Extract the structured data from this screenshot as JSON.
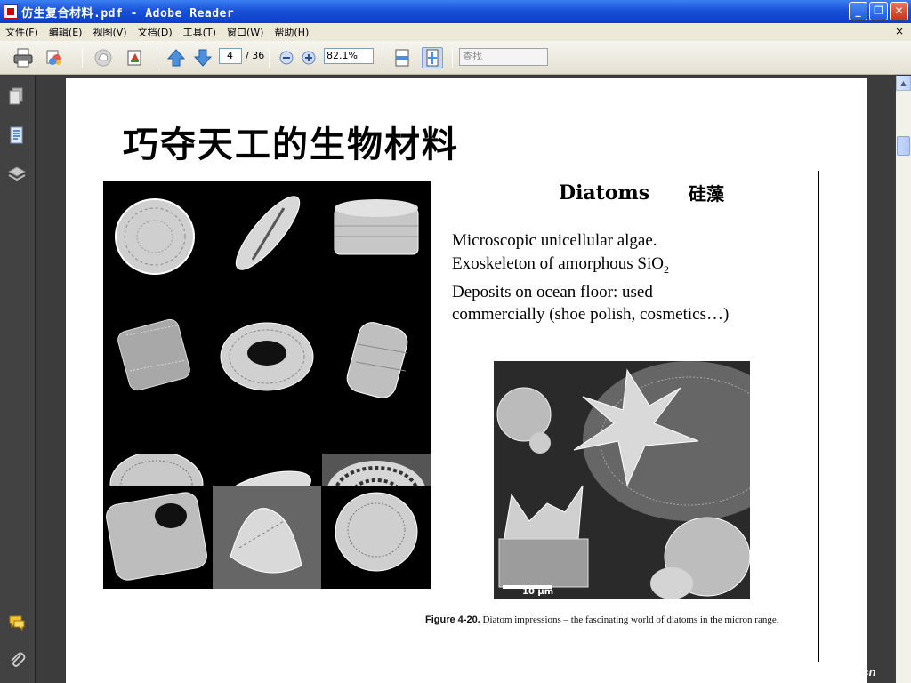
{
  "window": {
    "title": "仿生复合材料.pdf - Adobe Reader",
    "controls": {
      "minimize": "_",
      "restore": "❐",
      "close": "✕"
    }
  },
  "menu": {
    "items": [
      "文件(F)",
      "编辑(E)",
      "视图(V)",
      "文档(D)",
      "工具(T)",
      "窗口(W)",
      "帮助(H)"
    ],
    "close_glyph": "×"
  },
  "toolbar": {
    "current_page": "4",
    "total_pages": "/ 36",
    "zoom": "82.1%",
    "search_placeholder": "查找",
    "icons": [
      "print-icon",
      "share-icon",
      "hand-icon",
      "bookmark-icon",
      "prev-page-icon",
      "next-page-icon",
      "zoom-out-icon",
      "zoom-in-icon",
      "fit-width-icon",
      "fit-page-icon"
    ]
  },
  "sidebar": {
    "icons": [
      "pages-icon",
      "attachments-icon",
      "layers-icon",
      "comments-icon",
      "paperclip-icon"
    ]
  },
  "slide": {
    "title": "巧夺天工的生物材料",
    "heading": "Diatoms",
    "heading_cn": "硅藻",
    "bullets": {
      "line1": "Microscopic unicellular algae.",
      "line2_pre": "Exoskeleton of amorphous SiO",
      "line2_sub": "2",
      "line3": "Deposits on ocean floor: used",
      "line4": "commercially (shoe polish, cosmetics…)"
    },
    "scale_label": "10 µm",
    "caption_label": "Figure 4-20.",
    "caption_text": "Diatom impressions – the fascinating world of diatoms in the micron range."
  },
  "watermark": "al.cn"
}
